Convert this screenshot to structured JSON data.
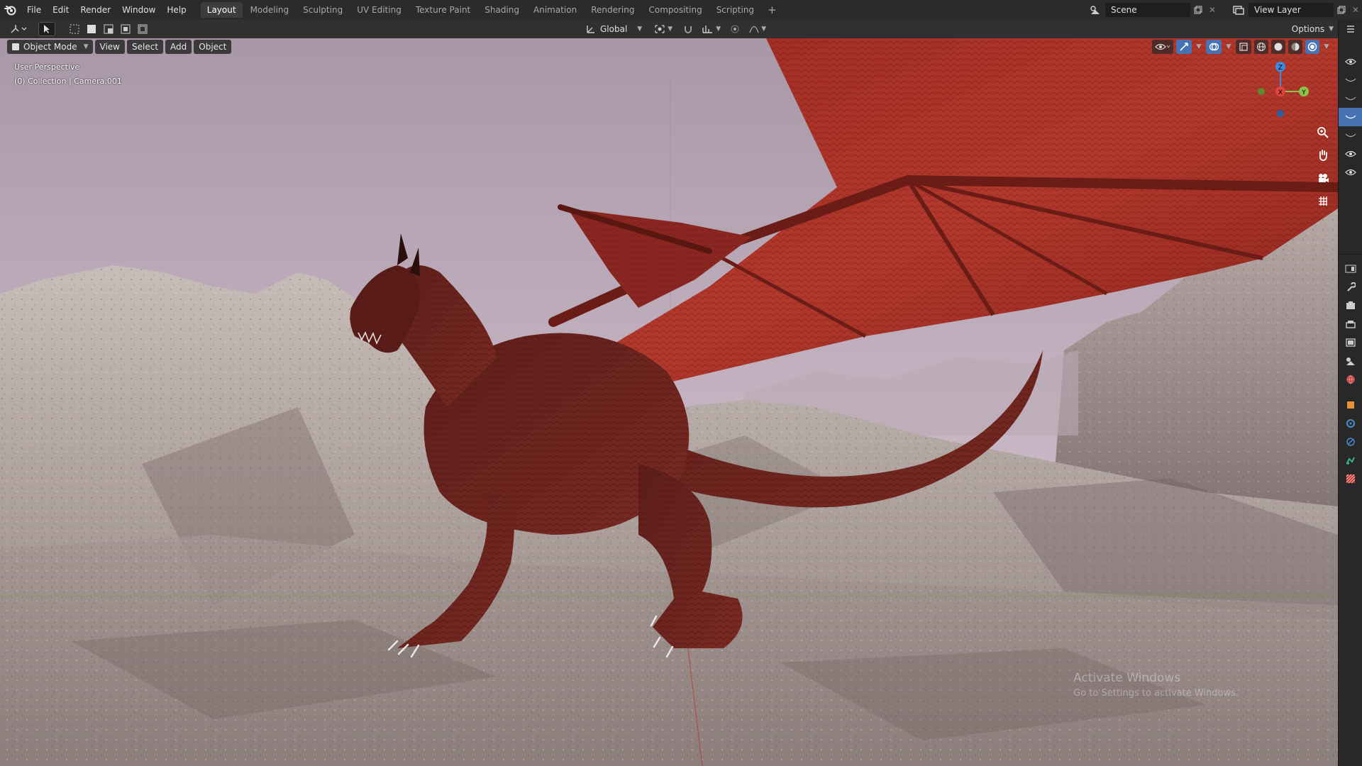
{
  "menubar": {
    "items": [
      "File",
      "Edit",
      "Render",
      "Window",
      "Help"
    ],
    "workspaces": [
      "Layout",
      "Modeling",
      "Sculpting",
      "UV Editing",
      "Texture Paint",
      "Shading",
      "Animation",
      "Rendering",
      "Compositing",
      "Scripting"
    ],
    "active_workspace": "Layout",
    "add_workspace": "+",
    "scene_name": "Scene",
    "view_layer": "View Layer"
  },
  "header": {
    "transform_orientation": "Global",
    "options_label": "Options"
  },
  "viewport": {
    "mode": "Object Mode",
    "menus": [
      "View",
      "Select",
      "Add",
      "Object"
    ],
    "perspective_label": "User Perspective",
    "collection_label": "(0) Collection | Camera.001",
    "gizmo": {
      "x": "X",
      "y": "Y",
      "z": "Z"
    },
    "watermark_title": "Activate Windows",
    "watermark_sub": "Go to Settings to activate Windows."
  },
  "icons": {
    "blender_logo": "blender-logo-icon",
    "editor_type": "3d-viewport-icon",
    "select_tool": "cursor-select-icon",
    "zoom": "zoom-icon",
    "pan": "hand-pan-icon",
    "camera": "camera-view-icon",
    "grid": "ortho-grid-icon",
    "visibility": "eye-icon"
  },
  "colors": {
    "accent": "#4772b3",
    "axis_x": "#e0443e",
    "axis_y": "#8bc34a",
    "axis_z": "#3d8be0"
  }
}
